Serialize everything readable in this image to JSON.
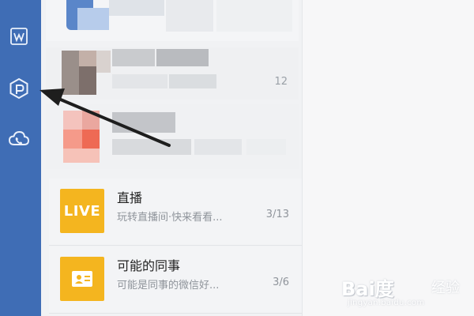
{
  "sidebar": {
    "items": [
      {
        "icon": "w-logo-icon"
      },
      {
        "icon": "workbench-hexagon-icon"
      },
      {
        "icon": "cloud-phone-icon"
      }
    ],
    "accent_color": "#3f6db5"
  },
  "list": {
    "items": [
      {
        "title": "",
        "subtitle": "",
        "count": "",
        "note": "pixelated"
      },
      {
        "title": "",
        "subtitle": "",
        "count": "12",
        "note": "pixelated"
      },
      {
        "title": "",
        "subtitle": "",
        "count": "",
        "note": "pixelated"
      },
      {
        "icon_label": "LIVE",
        "title": "直播",
        "subtitle": "玩转直播间·快来看看...",
        "count": "3/13",
        "icon_color": "#f4b51f"
      },
      {
        "icon": "contact-card-icon",
        "title": "可能的同事",
        "subtitle": "可能是同事的微信好...",
        "count": "3/6",
        "icon_color": "#f4b51f"
      }
    ]
  },
  "annotation": {
    "icon": "arrow-pointer",
    "color": "#1e1e1e"
  },
  "watermark": {
    "brand": "Bai度",
    "sub": "经验",
    "url": "jingyan.baidu.com"
  }
}
